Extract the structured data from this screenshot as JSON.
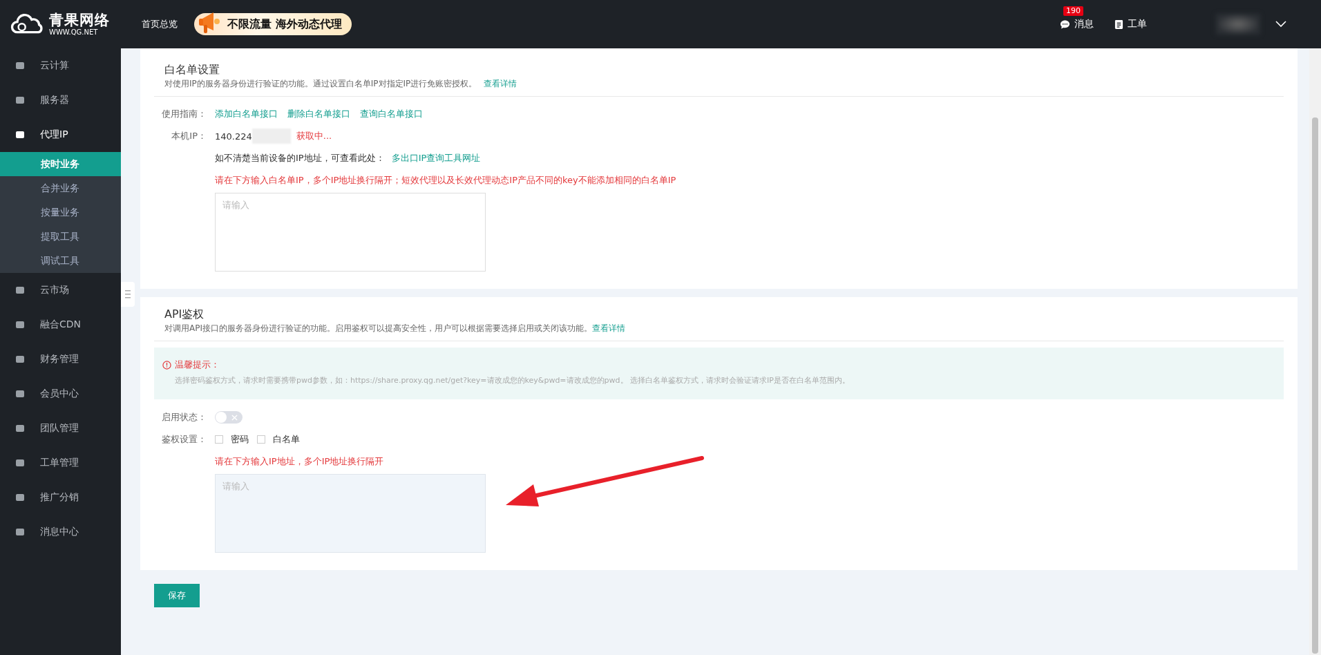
{
  "header": {
    "logo_name": "青果网络",
    "logo_url": "WWW.QG.NET",
    "nav": "首页总览",
    "banner": "不限流量 海外动态代理",
    "messages": {
      "label": "消息",
      "badge": "190"
    },
    "tickets": "工单"
  },
  "sidebar": {
    "items": [
      {
        "label": "云计算",
        "selected": false
      },
      {
        "label": "服务器",
        "selected": false
      },
      {
        "label": "代理IP",
        "selected": false,
        "expanded": true,
        "children": [
          {
            "label": "按时业务",
            "selected": true
          },
          {
            "label": "合并业务",
            "selected": false
          },
          {
            "label": "按量业务",
            "selected": false
          },
          {
            "label": "提取工具",
            "selected": false
          },
          {
            "label": "调试工具",
            "selected": false
          }
        ]
      },
      {
        "label": "云市场",
        "selected": false
      },
      {
        "label": "融合CDN",
        "selected": false
      },
      {
        "label": "财务管理",
        "selected": false
      },
      {
        "label": "会员中心",
        "selected": false
      },
      {
        "label": "团队管理",
        "selected": false
      },
      {
        "label": "工单管理",
        "selected": false
      },
      {
        "label": "推广分销",
        "selected": false
      },
      {
        "label": "消息中心",
        "selected": false
      }
    ]
  },
  "whitelist": {
    "title": "白名单设置",
    "description": "对使用IP的服务器身份进行验证的功能。通过设置白名单IP对指定IP进行免账密授权。",
    "details_link": "查看详情",
    "guide_label": "使用指南：",
    "guide_links": [
      "添加白名单接口",
      "删除白名单接口",
      "查询白名单接口"
    ],
    "ip_label": "本机IP：",
    "ip_value": "140.224",
    "ip_status": "获取中...",
    "hint": "如不清楚当前设备的IP地址，可查看此处：",
    "hint_link": "多出口IP查询工具网址",
    "warning": "请在下方输入白名单IP，多个IP地址换行隔开；短效代理以及长效代理动态IP产品不同的key不能添加相同的白名单IP",
    "input": {
      "placeholder": "请输入",
      "disabled": false
    }
  },
  "api_auth": {
    "title": "API鉴权",
    "description": "对调用API接口的服务器身份进行验证的功能。启用鉴权可以提高安全性，用户可以根据需要选择启用或关闭该功能。",
    "details_link": "查看详情",
    "tip_title": "温馨提示：",
    "tip_text": "选择密码鉴权方式，请求时需要携带pwd参数，如：https://share.proxy.qg.net/get?key=请改成您的key&pwd=请改成您的pwd。 选择白名单鉴权方式，请求时会验证请求IP是否在白名单范围内。",
    "status_label": "启用状态：",
    "status_on": false,
    "auth_label": "鉴权设置：",
    "options": [
      {
        "label": "密码",
        "checked": false
      },
      {
        "label": "白名单",
        "checked": false
      }
    ],
    "warning": "请在下方输入IP地址，多个IP地址换行隔开",
    "input": {
      "placeholder": "请输入",
      "disabled": true
    }
  },
  "save_button": "保存"
}
